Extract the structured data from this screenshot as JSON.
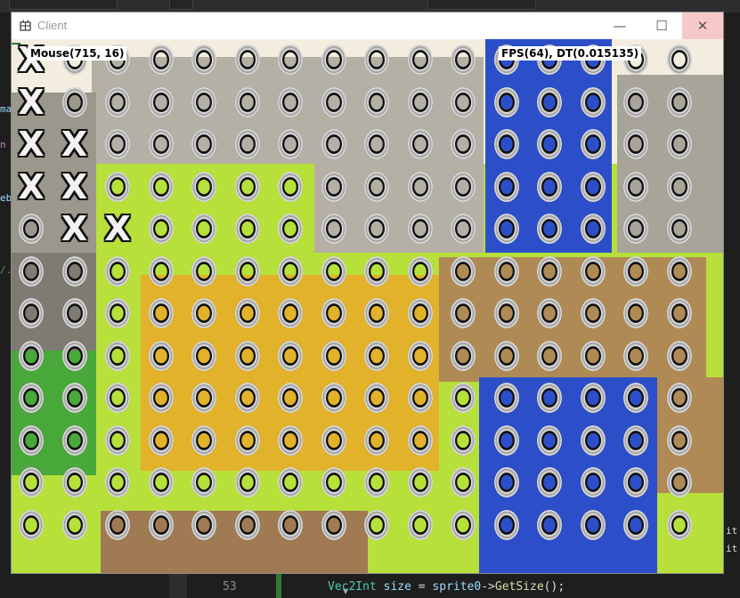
{
  "window": {
    "title": "Client",
    "controls": {
      "minimize": "—",
      "maximize": "☐",
      "close": "✕"
    }
  },
  "hud": {
    "mouse": "Mouse(715, 16)",
    "fps": "FPS(64), DT(0.015135)"
  },
  "board": {
    "rows": [
      "XOOOOOOOOOOOOOOOO",
      "XOOOOOOOOOOOOOOOO",
      "XXOOOOOOOOOOOOOOO",
      "XXOOOOOOOOOOOOOOO",
      "OXXOOOOOOOOOOOOOO",
      "OOOOOOOOOOOOOOOOO",
      "OOOOOOOOOOOOOOOOO",
      "OOOOOOOOOOOOOOOOO",
      "OOOOOOOOOOOOOOOOO",
      "OOOOOOOOOOOOOOOOO",
      "OOOOOOOOOOOOOOOOO",
      "OOOOOOOOOOOOOOOOO",
      "OOOOOOOOOOOOOOOOO"
    ],
    "x_symbol": "X",
    "o_symbol": "O"
  },
  "terrain_colors": {
    "grass": "#b7e03a",
    "stone_light": "#f3ede0",
    "stone": "#b5b0a5",
    "stone_dark": "#7f7b72",
    "water": "#2c4fc9",
    "sand": "#e1b22a",
    "dirt": "#b08a55",
    "dark_grass": "#49a83a"
  },
  "ide": {
    "line_number": "53",
    "code_tokens": {
      "type": "Vec2Int",
      "var": "size",
      "op": " = ",
      "obj": "sprite0",
      "arrow": "->",
      "func": "GetSize",
      "tail": "();"
    },
    "left_gutter_fragments": [
      "ma",
      "n",
      "eb",
      "/."
    ],
    "right_fragments": [
      "it",
      "it"
    ]
  }
}
